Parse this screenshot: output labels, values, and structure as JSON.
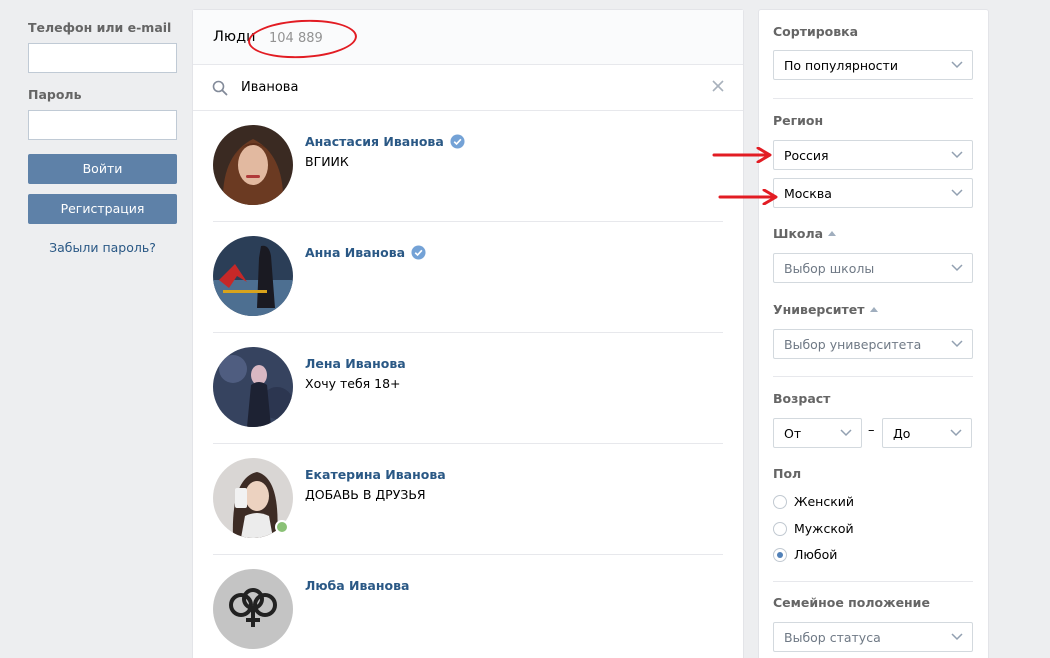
{
  "login": {
    "phone_label": "Телефон или e-mail",
    "password_label": "Пароль",
    "login_button": "Войти",
    "register_button": "Регистрация",
    "forgot_link": "Забыли пароль?"
  },
  "people": {
    "title": "Люди",
    "count": "104 889",
    "search_value": "Иванова",
    "list": [
      {
        "name": "Анастасия Иванова",
        "subtitle": "ВГИИК",
        "verified": true,
        "online": false
      },
      {
        "name": "Анна Иванова",
        "subtitle": "",
        "verified": true,
        "online": false
      },
      {
        "name": "Лена Иванова",
        "subtitle": "Хочу тебя 18+",
        "verified": false,
        "online": false
      },
      {
        "name": "Екатерина Иванова",
        "subtitle": "ДОБАВЬ В ДРУЗЬЯ",
        "verified": false,
        "online": true
      },
      {
        "name": "Люба Иванова",
        "subtitle": "",
        "verified": false,
        "online": false
      }
    ]
  },
  "filters": {
    "sort_label": "Сортировка",
    "sort_value": "По популярности",
    "region_label": "Регион",
    "country_value": "Россия",
    "city_value": "Москва",
    "school_label": "Школа",
    "school_placeholder": "Выбор школы",
    "university_label": "Университет",
    "university_placeholder": "Выбор университета",
    "age_label": "Возраст",
    "age_from": "От",
    "age_dash": "–",
    "age_to": "До",
    "gender_label": "Пол",
    "gender_options": [
      "Женский",
      "Мужской",
      "Любой"
    ],
    "gender_selected": "Любой",
    "marital_label": "Семейное положение",
    "marital_placeholder": "Выбор статуса"
  },
  "colors": {
    "accent": "#5e81a8",
    "link": "#2a5885",
    "annotation": "#e21c23",
    "online": "#8ac176"
  }
}
